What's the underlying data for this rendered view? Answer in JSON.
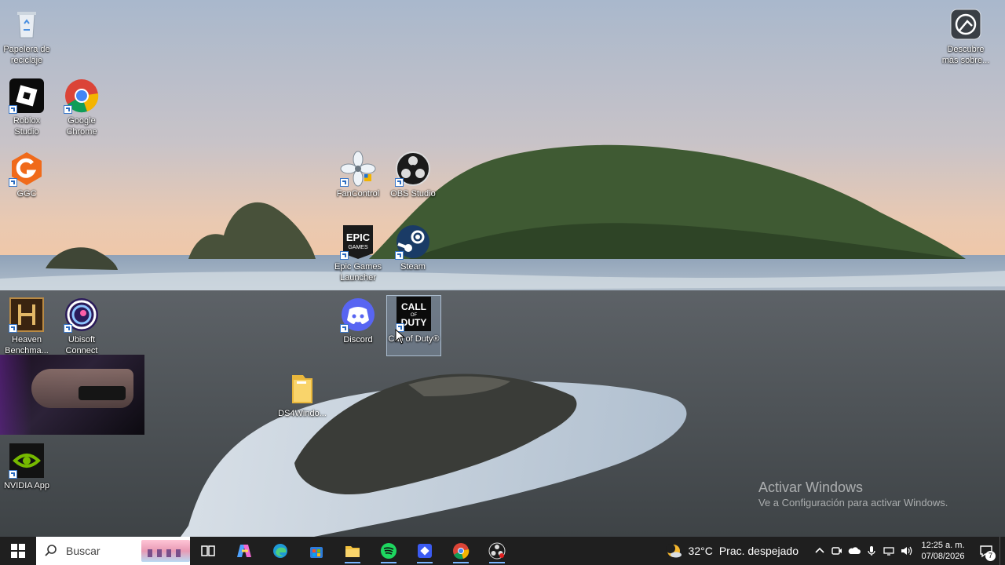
{
  "desktop": {
    "icons": [
      {
        "id": "recycle-bin",
        "label": "Papelera de reciclaje"
      },
      {
        "id": "roblox-studio",
        "label": "Roblox Studio"
      },
      {
        "id": "google-chrome",
        "label": "Google Chrome"
      },
      {
        "id": "ggc",
        "label": "GGC"
      },
      {
        "id": "fancontrol",
        "label": "FanControl"
      },
      {
        "id": "obs-studio",
        "label": "OBS Studio"
      },
      {
        "id": "epic-games",
        "label": "Epic Games Launcher"
      },
      {
        "id": "steam",
        "label": "Steam"
      },
      {
        "id": "heaven",
        "label": "Heaven Benchma..."
      },
      {
        "id": "ubisoft",
        "label": "Ubisoft Connect"
      },
      {
        "id": "discord",
        "label": "Discord"
      },
      {
        "id": "call-of-duty",
        "label": "Call of Duty®"
      },
      {
        "id": "ds4windows",
        "label": "DS4Windo..."
      },
      {
        "id": "nvidia-app",
        "label": "NVIDIA App"
      },
      {
        "id": "discover",
        "label": "Descubre más sobre..."
      }
    ],
    "selected_icon": "call-of-duty",
    "watermark": {
      "title": "Activar Windows",
      "subtitle": "Ve a Configuración para activar Windows."
    }
  },
  "taskbar": {
    "search_placeholder": "Buscar",
    "pinned": [
      "task-view",
      "copilot",
      "edge",
      "microsoft-store",
      "file-explorer",
      "spotify",
      "app-blue",
      "chrome",
      "obs-studio"
    ],
    "weather": {
      "temp": "32°C",
      "desc": "Prac. despejado"
    },
    "clock": {
      "time": "12:25 a. m.",
      "date": "07/08/2026"
    },
    "notifications": "7"
  },
  "colors": {
    "taskbar": "#1f1f1f",
    "accent": "#7ab5ff"
  }
}
